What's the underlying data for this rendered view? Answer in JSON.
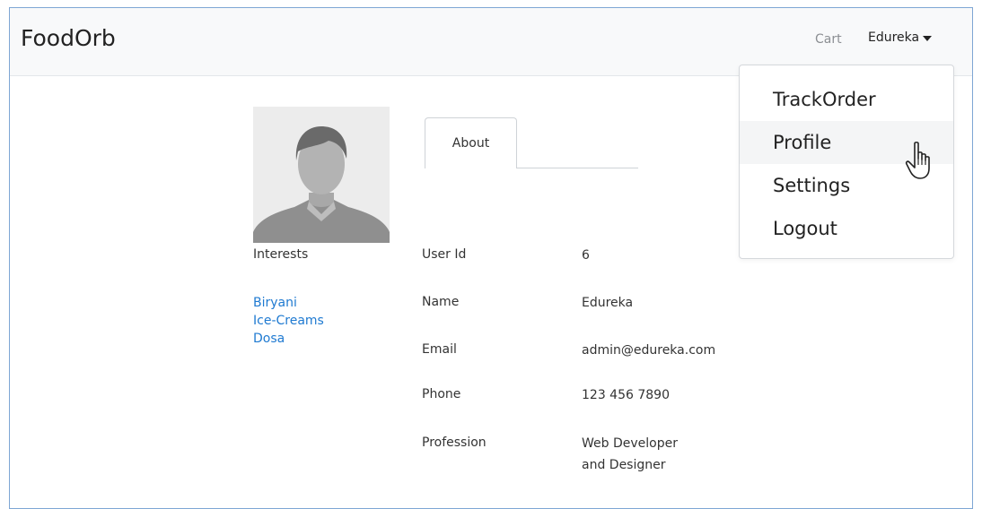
{
  "navbar": {
    "brand": "FoodOrb",
    "cart_label": "Cart",
    "user_label": "Edureka"
  },
  "dropdown": {
    "items": [
      {
        "label": "TrackOrder"
      },
      {
        "label": "Profile",
        "hovered": true
      },
      {
        "label": "Settings"
      },
      {
        "label": "Logout"
      }
    ]
  },
  "profile": {
    "avatar_icon": "default-user-avatar",
    "tab_label": "About",
    "interests_title": "Interests",
    "interests": [
      "Biryani",
      "Ice-Creams",
      "Dosa"
    ],
    "fields": [
      {
        "label": "User Id",
        "value": "6"
      },
      {
        "label": "Name",
        "value": "Edureka"
      },
      {
        "label": "Email",
        "value": "admin@edureka.com"
      },
      {
        "label": "Phone",
        "value": "123 456 7890"
      },
      {
        "label": "Profession",
        "value_lines": [
          "Web Developer",
          "and Designer"
        ]
      }
    ]
  },
  "colors": {
    "link": "#1f7ad1",
    "navbar_bg": "#f8f9fa",
    "frame_border": "#7ea6d4"
  }
}
